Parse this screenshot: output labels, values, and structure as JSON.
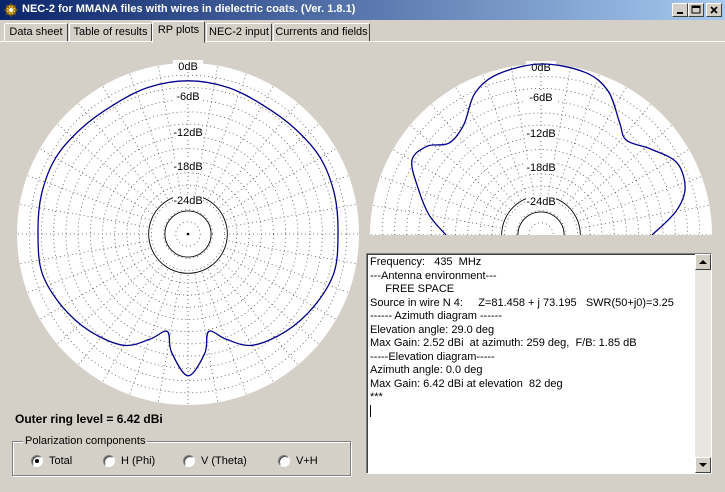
{
  "window": {
    "title": "NEC-2 for MMANA files with wires in dielectric coats. (Ver. 1.8.1)",
    "icon": "radiation-pattern-app-icon",
    "controls": [
      "minimize-icon",
      "maximize-icon",
      "close-icon"
    ]
  },
  "tabs": [
    {
      "label": "Data sheet"
    },
    {
      "label": "Table of results"
    },
    {
      "label": "RP plots",
      "active": true
    },
    {
      "label": "NEC-2 input"
    },
    {
      "label": "Currents and fields"
    }
  ],
  "plots": {
    "ring_labels": [
      "0dB",
      "-6dB",
      "-12dB",
      "-18dB",
      "-24dB"
    ],
    "trace_color": "#00008b",
    "azimuth": {
      "pattern_db": [
        {
          "deg": 0,
          "db": -3.65
        },
        {
          "deg": 15,
          "db": -3.9
        },
        {
          "deg": 30,
          "db": -4.5
        },
        {
          "deg": 45,
          "db": -4.3
        },
        {
          "deg": 60,
          "db": -3.75
        },
        {
          "deg": 75,
          "db": -3.95
        },
        {
          "deg": 90,
          "db": -4.3
        },
        {
          "deg": 105,
          "db": -4.1
        },
        {
          "deg": 120,
          "db": -5.3
        },
        {
          "deg": 135,
          "db": -6.8
        },
        {
          "deg": 150,
          "db": -8.8
        },
        {
          "deg": 160,
          "db": -12.3
        },
        {
          "deg": 168,
          "db": -15.0
        },
        {
          "deg": 172,
          "db": -10.5
        },
        {
          "deg": 180,
          "db": -6.0
        },
        {
          "deg": 188,
          "db": -10.8
        },
        {
          "deg": 192,
          "db": -15.0
        },
        {
          "deg": 200,
          "db": -12.3
        },
        {
          "deg": 210,
          "db": -8.8
        },
        {
          "deg": 225,
          "db": -6.8
        },
        {
          "deg": 240,
          "db": -5.3
        },
        {
          "deg": 255,
          "db": -4.1
        },
        {
          "deg": 270,
          "db": -4.3
        },
        {
          "deg": 285,
          "db": -3.95
        },
        {
          "deg": 300,
          "db": -3.75
        },
        {
          "deg": 315,
          "db": -4.3
        },
        {
          "deg": 330,
          "db": -4.5
        },
        {
          "deg": 345,
          "db": -3.9
        }
      ]
    },
    "elevation": {
      "pattern_db": [
        {
          "deg": -90,
          "db": -16
        },
        {
          "deg": -80,
          "db": -12
        },
        {
          "deg": -70,
          "db": -8.5
        },
        {
          "deg": -60,
          "db": -4.5
        },
        {
          "deg": -52,
          "db": -5.5
        },
        {
          "deg": -45,
          "db": -8.5
        },
        {
          "deg": -35,
          "db": -7.5
        },
        {
          "deg": -25,
          "db": -3.0
        },
        {
          "deg": -15,
          "db": -0.9
        },
        {
          "deg": 0,
          "db": 0
        },
        {
          "deg": 15,
          "db": -0.5
        },
        {
          "deg": 25,
          "db": -2.5
        },
        {
          "deg": 35,
          "db": -7.0
        },
        {
          "deg": 42,
          "db": -9.0
        },
        {
          "deg": 52,
          "db": -6.5
        },
        {
          "deg": 62,
          "db": -3.5
        },
        {
          "deg": 72,
          "db": -4.0
        },
        {
          "deg": 80,
          "db": -7.0
        },
        {
          "deg": 90,
          "db": -12.5
        }
      ]
    }
  },
  "outer_ring_text": "Outer ring level = 6.42 dBi",
  "polarization": {
    "title": "Polarization components",
    "options": [
      {
        "label": "Total",
        "selected": true
      },
      {
        "label": "H (Phi)",
        "selected": false
      },
      {
        "label": "V (Theta)",
        "selected": false
      },
      {
        "label": "V+H",
        "selected": false
      }
    ]
  },
  "results_text": [
    "Frequency:   435  MHz",
    "---Antenna environment---",
    "     FREE SPACE",
    "Source in wire N 4:     Z=81.458 + j 73.195   SWR(50+j0)=3.25",
    "------ Azimuth diagram ------",
    "Elevation angle: 29.0 deg",
    "Max Gain: 2.52 dBi  at azimuth: 259 deg,  F/B: 1.85 dB",
    "-----Elevation diagram-----",
    "Azimuth angle: 0.0 deg",
    "Max Gain: 6.42 dBi at elevation  82 deg",
    "***"
  ]
}
